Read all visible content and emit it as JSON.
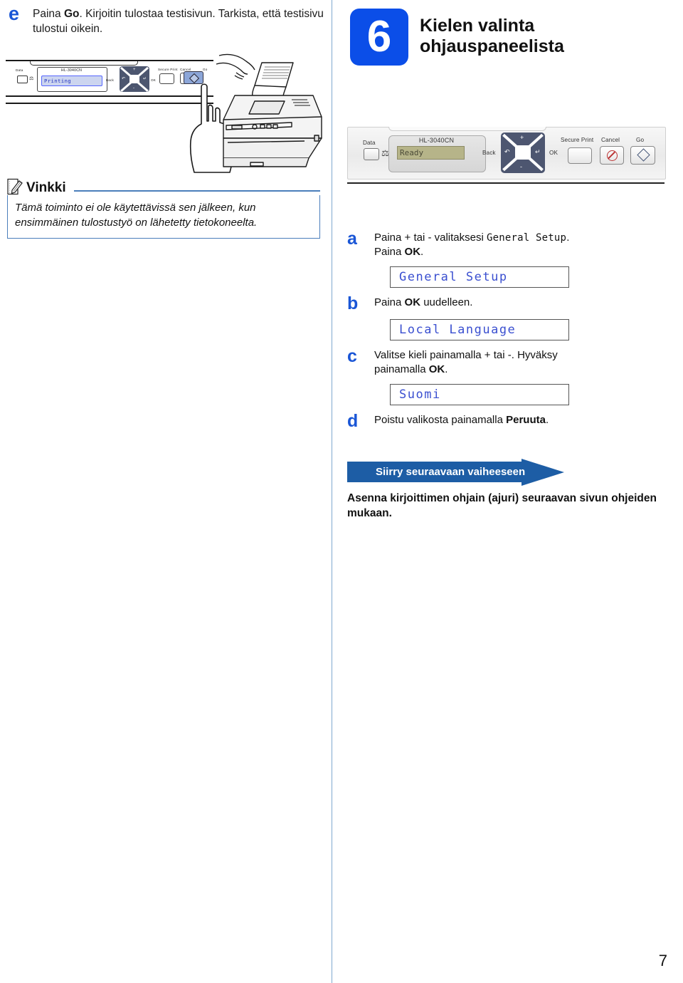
{
  "left": {
    "step_letter": "e",
    "step_text_plain": "Paina Go. Kirjoitin tulostaa testisivun. Tarkista, että testisivu tulostui oikein.",
    "step_text_lead": "Paina ",
    "step_text_bold": "Go",
    "step_text_rest": ". Kirjoitin tulostaa testisivun. Tarkista, että testisivu tulostui oikein.",
    "panel": {
      "data_label": "Data",
      "model_label": "HL-3040CN",
      "lcd_text": "Printing",
      "back_label": "Back",
      "ok_label": "OK",
      "secure_print_label": "Secure Print",
      "cancel_label": "Cancel",
      "go_label": "Go",
      "plus_glyph": "+",
      "minus_glyph": "-"
    },
    "note": {
      "title": "Vinkki",
      "body": "Tämä toiminto ei ole käytettävissä sen jälkeen, kun ensimmäinen tulostustyö on lähetetty tietokoneelta."
    }
  },
  "right": {
    "step_number": "6",
    "title_line1": "Kielen valinta",
    "title_line2": "ohjauspaneelista",
    "panel": {
      "data_label": "Data",
      "model_label": "HL-3040CN",
      "lcd_text": "Ready",
      "back_label": "Back",
      "ok_label": "OK",
      "secure_print_label": "Secure Print",
      "cancel_label": "Cancel",
      "go_label": "Go",
      "plus_glyph": "+",
      "minus_glyph": "-"
    },
    "substeps": [
      {
        "mark": "a",
        "pre": "Paina + tai - valitaksesi ",
        "mono": "General Setup",
        "post": ".",
        "line2_pre": "Paina ",
        "line2_bold": "OK",
        "line2_post": ".",
        "lcd": "General Setup"
      },
      {
        "mark": "b",
        "pre": "Paina ",
        "bold": "OK",
        "post": " uudelleen.",
        "lcd": "Local Language"
      },
      {
        "mark": "c",
        "pre": "Valitse kieli painamalla + tai -. Hyväksy",
        "line2_pre": "painamalla ",
        "line2_bold": "OK",
        "line2_post": ".",
        "lcd": "Suomi"
      },
      {
        "mark": "d",
        "pre": "Poistu valikosta painamalla ",
        "bold": "Peruuta",
        "post": "."
      }
    ],
    "banner_label": "Siirry seuraavaan vaiheeseen",
    "footer_note": "Asenna kirjoittimen ohjain (ajuri) seuraavan sivun ohjeiden mukaan."
  },
  "page_number": "7",
  "colors": {
    "step_blue": "#0b4ee8",
    "letter_blue": "#1a56d6",
    "banner_blue": "#1d5da5",
    "note_border": "#4a7ebb",
    "lcd_text_blue": "#3a4fd0",
    "divider": "#7fa8cf"
  }
}
